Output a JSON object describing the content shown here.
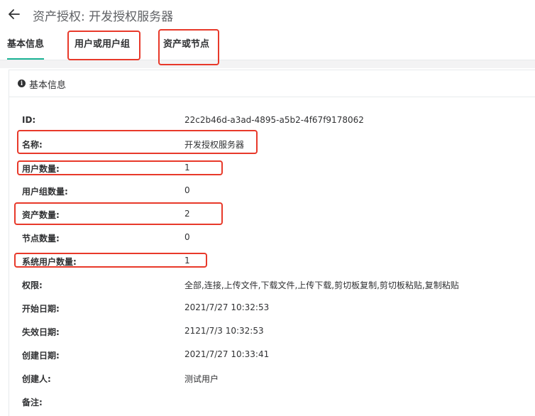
{
  "page": {
    "title": "资产授权: 开发授权服务器"
  },
  "tabs": [
    {
      "label": "基本信息",
      "active": true
    },
    {
      "label": "用户或用户组",
      "active": false
    },
    {
      "label": "资产或节点",
      "active": false
    }
  ],
  "panel": {
    "title": "基本信息",
    "rows": [
      {
        "label": "ID:",
        "value": "22c2b46d-a3ad-4895-a5b2-4f67f9178062"
      },
      {
        "label": "名称:",
        "value": "开发授权服务器"
      },
      {
        "label": "用户数量:",
        "value": "1"
      },
      {
        "label": "用户组数量:",
        "value": "0"
      },
      {
        "label": "资产数量:",
        "value": "2"
      },
      {
        "label": "节点数量:",
        "value": "0"
      },
      {
        "label": "系统用户数量:",
        "value": "1"
      },
      {
        "label": "权限:",
        "value": "全部,连接,上传文件,下载文件,上传下载,剪切板复制,剪切板粘贴,复制粘贴"
      },
      {
        "label": "开始日期:",
        "value": "2021/7/27 10:32:53"
      },
      {
        "label": "失效日期:",
        "value": "2121/7/3 10:32:53"
      },
      {
        "label": "创建日期:",
        "value": "2021/7/27 10:33:41"
      },
      {
        "label": "创建人:",
        "value": "测试用户"
      },
      {
        "label": "备注:",
        "value": ""
      }
    ]
  },
  "colors": {
    "accent": "#1ab394",
    "highlight_outline": "#e8392a"
  },
  "icons": {
    "back": "arrow-left-icon",
    "info": "info-circle-icon"
  }
}
